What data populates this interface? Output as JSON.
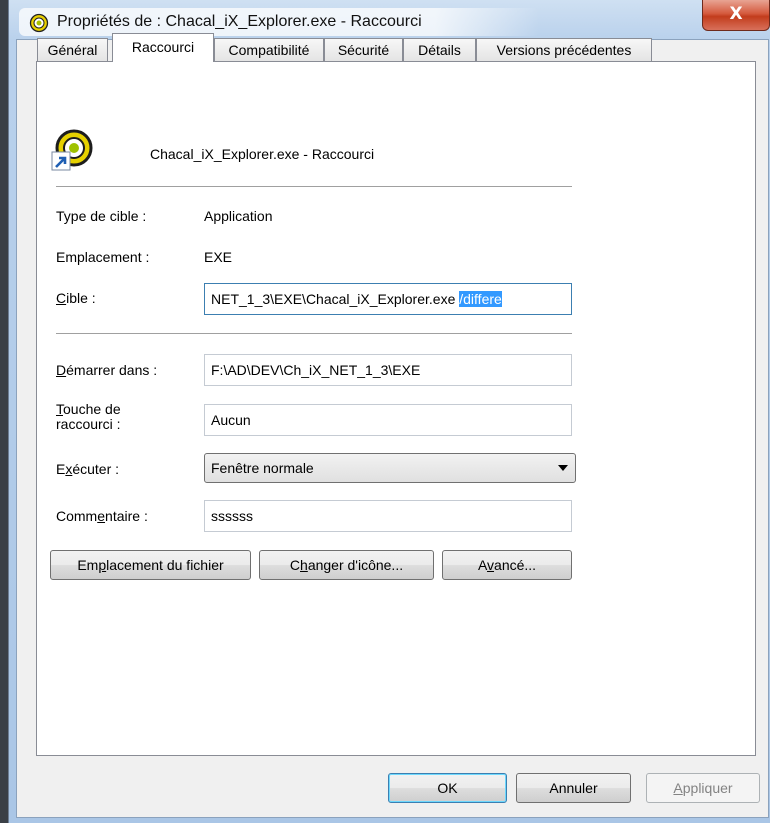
{
  "window": {
    "title": "Propriétés de : Chacal_iX_Explorer.exe - Raccourci",
    "close_label": "X"
  },
  "tabs": [
    {
      "label": "Général",
      "active": false
    },
    {
      "label": "Raccourci",
      "active": true
    },
    {
      "label": "Compatibilité",
      "active": false
    },
    {
      "label": "Sécurité",
      "active": false
    },
    {
      "label": "Détails",
      "active": false
    },
    {
      "label": "Versions précédentes",
      "active": false
    }
  ],
  "header": {
    "shortcut_name": "Chacal_iX_Explorer.exe - Raccourci",
    "icon": "shortcut-app-icon"
  },
  "fields": {
    "target_type": {
      "label": "Type de cible :",
      "value": "Application"
    },
    "location": {
      "label": "Emplacement :",
      "value": "EXE"
    },
    "target": {
      "label": "Cible :",
      "value": "NET_1_3\\EXE\\Chacal_iX_Explorer.exe ",
      "selected": "/differe"
    },
    "start_in": {
      "label": "Démarrer dans :",
      "value": "F:\\AD\\DEV\\Ch_iX_NET_1_3\\EXE"
    },
    "shortcut_key": {
      "label_line1": "Touche de",
      "label_line2": "raccourci :",
      "value": "Aucun"
    },
    "run": {
      "label": "Exécuter :",
      "value": "Fenêtre normale"
    },
    "comment": {
      "label": "Commentaire :",
      "value": "ssssss"
    }
  },
  "actions": {
    "open_location": "Emplacement du fichier",
    "change_icon": "Changer d'icône...",
    "advanced": "Avancé..."
  },
  "footer": {
    "ok": "OK",
    "cancel": "Annuler",
    "apply": "Appliquer"
  },
  "colors": {
    "selection": "#3399ff",
    "close_button": "#c23c1c",
    "titlebar": "#b9d1ec"
  }
}
